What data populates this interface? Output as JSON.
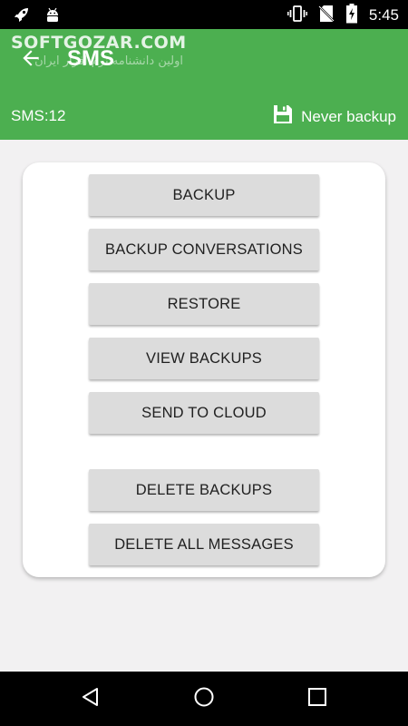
{
  "status_bar": {
    "time": "5:45",
    "icons": [
      "rocket-icon",
      "android-icon",
      "vibrate-icon",
      "no-sim-icon",
      "battery-charging-icon"
    ]
  },
  "app_bar": {
    "title": "SMS",
    "watermark": "SOFTGOZAR.COM",
    "watermark_sub": "اولین دانشنامه نرم افزار ایران",
    "sms_count": "SMS:12",
    "backup_status": "Never backup",
    "color": "#4caf50"
  },
  "actions": {
    "backup": "BACKUP",
    "backup_conversations": "BACKUP CONVERSATIONS",
    "restore": "RESTORE",
    "view_backups": "VIEW BACKUPS",
    "send_to_cloud": "SEND TO CLOUD",
    "delete_backups": "DELETE BACKUPS",
    "delete_all_messages": "DELETE ALL MESSAGES"
  },
  "nav_bar": {
    "icons": [
      "nav-back-icon",
      "nav-home-icon",
      "nav-recents-icon"
    ]
  }
}
